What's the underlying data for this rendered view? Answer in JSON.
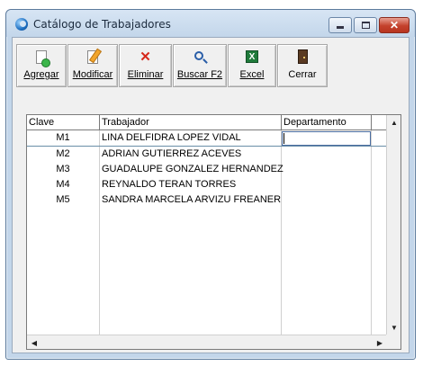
{
  "window": {
    "title": "Catálogo de Trabajadores"
  },
  "toolbar": {
    "buttons": [
      {
        "label": "Agregar",
        "icon": "add-document-icon"
      },
      {
        "label": "Modificar",
        "icon": "edit-document-icon"
      },
      {
        "label": "Eliminar",
        "icon": "delete-x-icon"
      },
      {
        "label": "Buscar F2",
        "icon": "search-icon"
      },
      {
        "label": "Excel",
        "icon": "excel-icon"
      },
      {
        "label": "Cerrar",
        "icon": "door-exit-icon"
      }
    ]
  },
  "grid": {
    "columns": [
      "Clave",
      "Trabajador",
      "Departamento"
    ],
    "rows": [
      {
        "clave": "M1",
        "trabajador": "LINA DELFIDRA LOPEZ VIDAL",
        "departamento": ""
      },
      {
        "clave": "M2",
        "trabajador": "ADRIAN GUTIERREZ ACEVES",
        "departamento": ""
      },
      {
        "clave": "M3",
        "trabajador": "GUADALUPE GONZALEZ HERNANDEZ",
        "departamento": ""
      },
      {
        "clave": "M4",
        "trabajador": "REYNALDO TERAN TORRES",
        "departamento": ""
      },
      {
        "clave": "M5",
        "trabajador": "SANDRA MARCELA ARVIZU FREANER",
        "departamento": ""
      }
    ]
  },
  "colors": {
    "frame": "#c3d6ea",
    "close_button": "#c4412c",
    "selection_line": "#6a8ea8"
  }
}
